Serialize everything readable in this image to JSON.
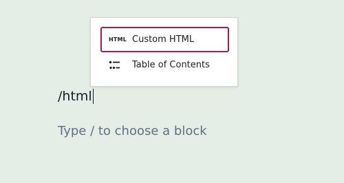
{
  "inserter": {
    "items": [
      {
        "icon": "html-icon",
        "icon_text": "HTML",
        "label": "Custom HTML",
        "selected": true
      },
      {
        "icon": "table-of-contents-icon",
        "label": "Table of Contents",
        "selected": false
      }
    ]
  },
  "editor": {
    "typed_text": "/html",
    "placeholder": "Type / to choose a block"
  },
  "colors": {
    "background": "#e5eee6",
    "selection_border": "#b5144f",
    "text": "#161b2a",
    "placeholder": "#5f6f84"
  }
}
